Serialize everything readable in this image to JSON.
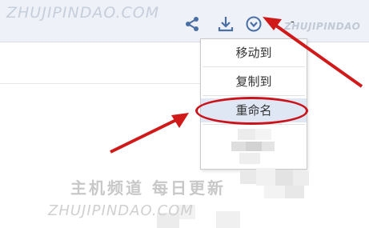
{
  "watermarks": {
    "top_left": "ZHUJIPINDAO.COM",
    "top_right": "ZHUJIPINDAO",
    "bottom_cn": "主机频道 每日更新",
    "bottom_en": "ZHUJIPINDAO.COM"
  },
  "toolbar": {
    "icons": [
      "share-icon",
      "download-icon",
      "more-dropdown-icon"
    ],
    "trailing_text": "-"
  },
  "context_menu": {
    "items": [
      {
        "label": "移动到"
      },
      {
        "label": "复制到"
      },
      {
        "label": "重命名",
        "highlighted": true
      }
    ]
  },
  "colors": {
    "accent_icon": "#4a6fa5",
    "annotation_red": "#d01a1a",
    "menu_hover": "#dfe6f4"
  }
}
